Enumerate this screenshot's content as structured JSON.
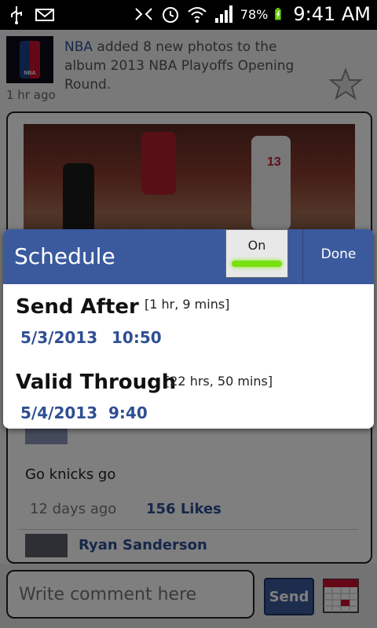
{
  "status_bar": {
    "icons_left": [
      "usb-icon",
      "mail-icon"
    ],
    "icons_right": [
      "nfc-icon",
      "alarm-icon",
      "wifi-icon",
      "signal-icon"
    ],
    "battery_percent": "78%",
    "time": "9:41 AM"
  },
  "post": {
    "author": "NBA",
    "text": " added 8 new photos to the album 2013 NBA Playoffs Opening Round.",
    "time": "1 hr ago"
  },
  "photo": {
    "jersey_number": "13"
  },
  "comment": {
    "text": "Go knicks go",
    "time": "12 days ago",
    "likes": "156 Likes",
    "next_commenter": "Ryan Sanderson"
  },
  "composer": {
    "placeholder": "Write comment here",
    "send_label": "Send"
  },
  "schedule_dialog": {
    "title": "Schedule",
    "toggle_label": "On",
    "done_label": "Done",
    "send_after": {
      "label": "Send After",
      "relative": "[1 hr, 9 mins]",
      "date": "5/3/2013",
      "time": "10:50"
    },
    "valid_through": {
      "label": "Valid Through",
      "relative": "[22 hrs, 50 mins]",
      "date": "5/4/2013",
      "time": "9:40"
    }
  },
  "colors": {
    "accent": "#3b5a9d",
    "link": "#2f4f92",
    "toggle_on": "#78e010"
  }
}
